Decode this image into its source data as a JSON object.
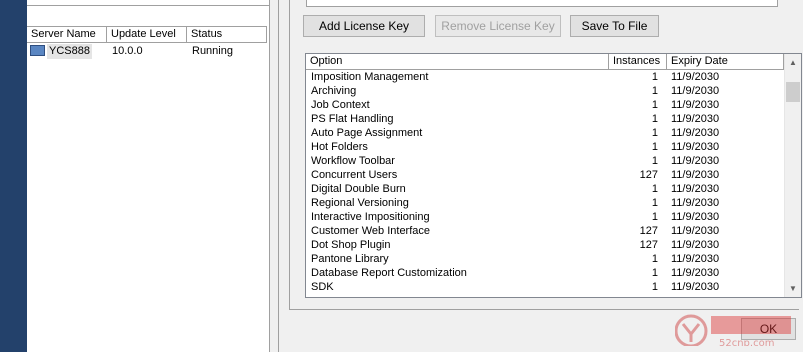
{
  "server_list": {
    "columns": [
      "Server Name",
      "Update Level",
      "Status"
    ],
    "rows": [
      {
        "name": "YCS888",
        "update_level": "10.0.0",
        "status": "Running",
        "icon": "server-icon"
      }
    ]
  },
  "toolbar": {
    "add_label": "Add License Key",
    "remove_label": "Remove License Key",
    "save_label": "Save To File"
  },
  "license_list": {
    "columns": [
      "Option",
      "Instances",
      "Expiry Date"
    ],
    "rows": [
      {
        "option": "Imposition Management",
        "instances": "1",
        "expiry": "11/9/2030"
      },
      {
        "option": "Archiving",
        "instances": "1",
        "expiry": "11/9/2030"
      },
      {
        "option": "Job Context",
        "instances": "1",
        "expiry": "11/9/2030"
      },
      {
        "option": "PS Flat Handling",
        "instances": "1",
        "expiry": "11/9/2030"
      },
      {
        "option": "Auto Page Assignment",
        "instances": "1",
        "expiry": "11/9/2030"
      },
      {
        "option": "Hot Folders",
        "instances": "1",
        "expiry": "11/9/2030"
      },
      {
        "option": "Workflow Toolbar",
        "instances": "1",
        "expiry": "11/9/2030"
      },
      {
        "option": "Concurrent Users",
        "instances": "127",
        "expiry": "11/9/2030"
      },
      {
        "option": "Digital Double Burn",
        "instances": "1",
        "expiry": "11/9/2030"
      },
      {
        "option": "Regional Versioning",
        "instances": "1",
        "expiry": "11/9/2030"
      },
      {
        "option": "Interactive Impositioning",
        "instances": "1",
        "expiry": "11/9/2030"
      },
      {
        "option": "Customer Web Interface",
        "instances": "127",
        "expiry": "11/9/2030"
      },
      {
        "option": "Dot Shop Plugin",
        "instances": "127",
        "expiry": "11/9/2030"
      },
      {
        "option": "Pantone Library",
        "instances": "1",
        "expiry": "11/9/2030"
      },
      {
        "option": "Database Report Customization",
        "instances": "1",
        "expiry": "11/9/2030"
      },
      {
        "option": "SDK",
        "instances": "1",
        "expiry": "11/9/2030"
      }
    ]
  },
  "dialog": {
    "ok_label": "OK"
  },
  "watermark": {
    "text": "52cnp.com"
  },
  "colors": {
    "left_strip": "#23416b",
    "selection_icon": "#5a86c2"
  }
}
